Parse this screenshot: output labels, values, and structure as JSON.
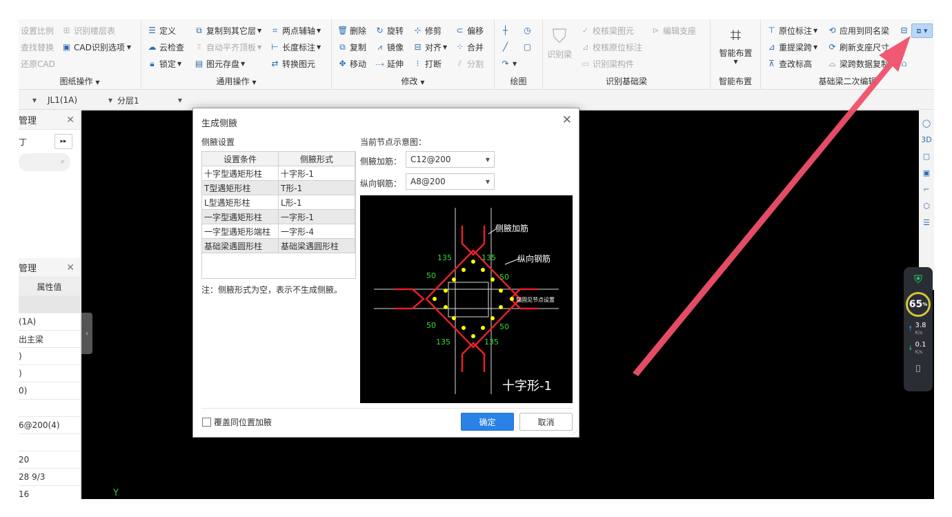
{
  "ribbon": {
    "group_drawing": {
      "title": "图纸操作",
      "items": [
        "设置比例",
        "识别楼层表",
        "查找替换",
        "CAD识别选项",
        "还原CAD"
      ]
    },
    "group_common": {
      "title": "通用操作",
      "items": [
        "定义",
        "复制到其它层",
        "两点辅轴",
        "云检查",
        "自动平齐顶板",
        "长度标注",
        "锁定",
        "图元存盘",
        "转换图元"
      ]
    },
    "group_modify": {
      "title": "修改",
      "items": [
        "删除",
        "旋转",
        "修剪",
        "偏移",
        "复制",
        "镜像",
        "对齐",
        "合并",
        "移动",
        "延伸",
        "打断",
        "分割"
      ]
    },
    "group_draw": {
      "title": "绘图"
    },
    "group_identify": {
      "title": "识别基础梁",
      "big": "识别梁",
      "items": [
        "校核梁图元",
        "编辑支座",
        "校核原位标注",
        "识别梁构件"
      ]
    },
    "group_smart": {
      "title": "智能布置",
      "big": "智能布置"
    },
    "group_secondary": {
      "title": "基础梁二次编辑",
      "items": [
        "原位标注",
        "应用到同名梁",
        "重提梁跨",
        "刷新支座尺寸",
        "查改标高",
        "梁跨数据复制"
      ]
    }
  },
  "toolbar2": {
    "combo1": "JL1(1A)",
    "combo2": "分层1"
  },
  "left_panel": {
    "panel1_title": "管理",
    "panel2_title": "管理",
    "prop_header": "属性值",
    "prop_values": [
      "(1A)",
      "出主梁",
      ")",
      ")",
      "0)",
      "",
      "6@200(4)",
      "",
      "20",
      "28 9/3",
      "16"
    ]
  },
  "net_widget": {
    "percent": "65",
    "percent_unit": "%",
    "up": "3.8",
    "down": "0.1",
    "unit": "K/s"
  },
  "dialog": {
    "title": "生成侧腋",
    "section_label": "侧腋设置",
    "preview_label": "当前节点示意图：",
    "table_headers": [
      "设置条件",
      "侧腋形式"
    ],
    "rows": [
      {
        "condition": "十字型遇矩形柱",
        "form": "十字形-1"
      },
      {
        "condition": "T型遇矩形柱",
        "form": "T形-1"
      },
      {
        "condition": "L型遇矩形柱",
        "form": "L形-1"
      },
      {
        "condition": "一字型遇矩形柱",
        "form": "一字形-1"
      },
      {
        "condition": "一字型遇矩形端柱",
        "form": "一字形-4"
      },
      {
        "condition": "基础梁遇圆形柱",
        "form": "基础梁遇圆形柱"
      }
    ],
    "note": "注：侧腋形式为空，表示不生成侧腋。",
    "side_bar_label": "侧腋加筋：",
    "side_bar_value": "C12@200",
    "long_bar_label": "纵向钢筋：",
    "long_bar_value": "A8@200",
    "preview": {
      "label_side": "侧腋加筋",
      "label_long": "纵向钢筋",
      "label_anchor": "锚固见节点设置",
      "dim_135": "135",
      "dim_50": "50",
      "caption": "十字形-1"
    },
    "checkbox_label": "覆盖同位置加腋",
    "ok": "确定",
    "cancel": "取消"
  },
  "canvas": {
    "axis_label": "Y"
  },
  "colors": {
    "accent": "#2b82e6",
    "arrow": "#f0506a",
    "rebar": "#e8202a",
    "dot": "#ffff00",
    "dim": "#33dd33"
  }
}
